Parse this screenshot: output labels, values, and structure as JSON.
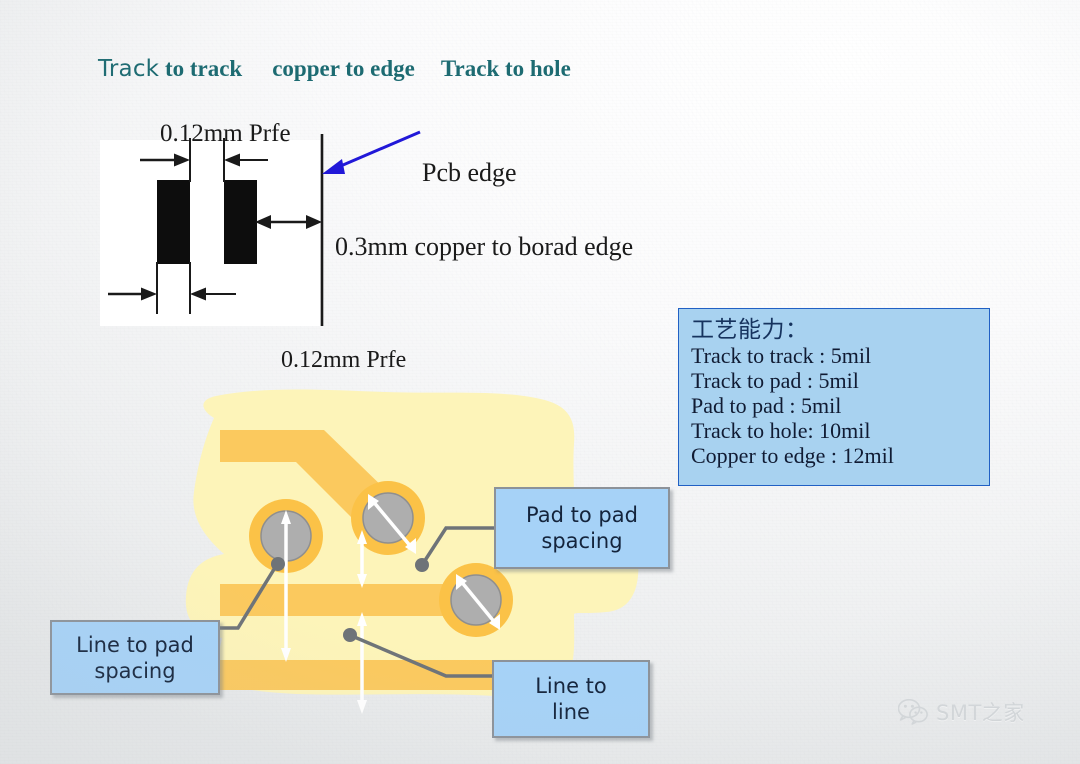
{
  "heading": {
    "part1": "Track",
    "part2": " to track",
    "part3": "copper to edge",
    "part4": "Track to hole"
  },
  "tech_panel": {
    "top_label": "0.12mm  Prfe",
    "bottom_label": "0.12mm  Prfe",
    "pcb_edge_label": "Pcb edge",
    "copper_edge_label": "0.3mm copper to borad edge",
    "arrow_color": "#2118d8",
    "panel_fill": "#ffffff",
    "pad_fill": "#0d0d0d"
  },
  "spec_box": {
    "title": "工艺能力：",
    "lines": [
      "Track to track : 5mil",
      "Track to pad : 5mil",
      "Pad to pad : 5mil",
      "Track to hole: 10mil",
      "Copper to edge : 12mil"
    ],
    "fill": "#a8d2f0",
    "border": "#2160c4"
  },
  "callouts": {
    "pad_to_pad": "Pad to pad\nspacing",
    "pad_to_pad_l1": "Pad to pad",
    "pad_to_pad_l2": "spacing",
    "line_to_line_l1": "Line to",
    "line_to_line_l2": "line",
    "line_to_pad_l1": "Line to pad",
    "line_to_pad_l2": "spacing",
    "fill": "#a6d2f7",
    "border": "#8c9299"
  },
  "pcb": {
    "soldermask_fill": "#fdf4b9",
    "trace_fill": "#fbc95e",
    "pad_ring_fill": "#fbc247",
    "via_fill": "#aeaeae",
    "via_stroke": "#8f8f8f",
    "leader_color": "#6e7378",
    "dim_arrow_color": "#ffffff"
  },
  "watermark": {
    "icon": "wechat-icon",
    "text": "SMT之家"
  }
}
